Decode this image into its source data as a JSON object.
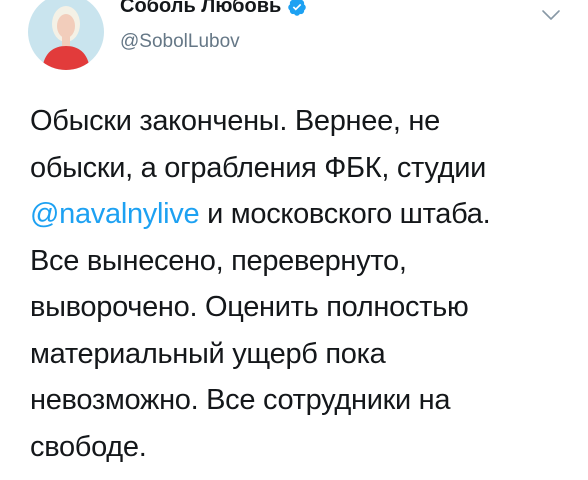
{
  "author": {
    "display_name": "Соболь Любовь",
    "handle": "@SobolLubov",
    "verified": true
  },
  "tweet": {
    "line1": "Обыски закончены. Вернее, не",
    "line2": "обыски, а ограбления ФБК, студии",
    "line3_mention": "@navalnylive",
    "line3_rest": " и московского штаба.",
    "line4": "Все вынесено, перевернуто,",
    "line5": "выворочено. Оценить полностью",
    "line6": "материальный ущерб пока",
    "line7": "невозможно. Все сотрудники на",
    "line8": "свободе."
  },
  "icons": {
    "verified": "verified-badge-icon",
    "menu": "chevron-down-icon"
  },
  "colors": {
    "text": "#14171a",
    "secondary": "#657786",
    "link": "#1da1f2",
    "verified": "#1da1f2"
  }
}
